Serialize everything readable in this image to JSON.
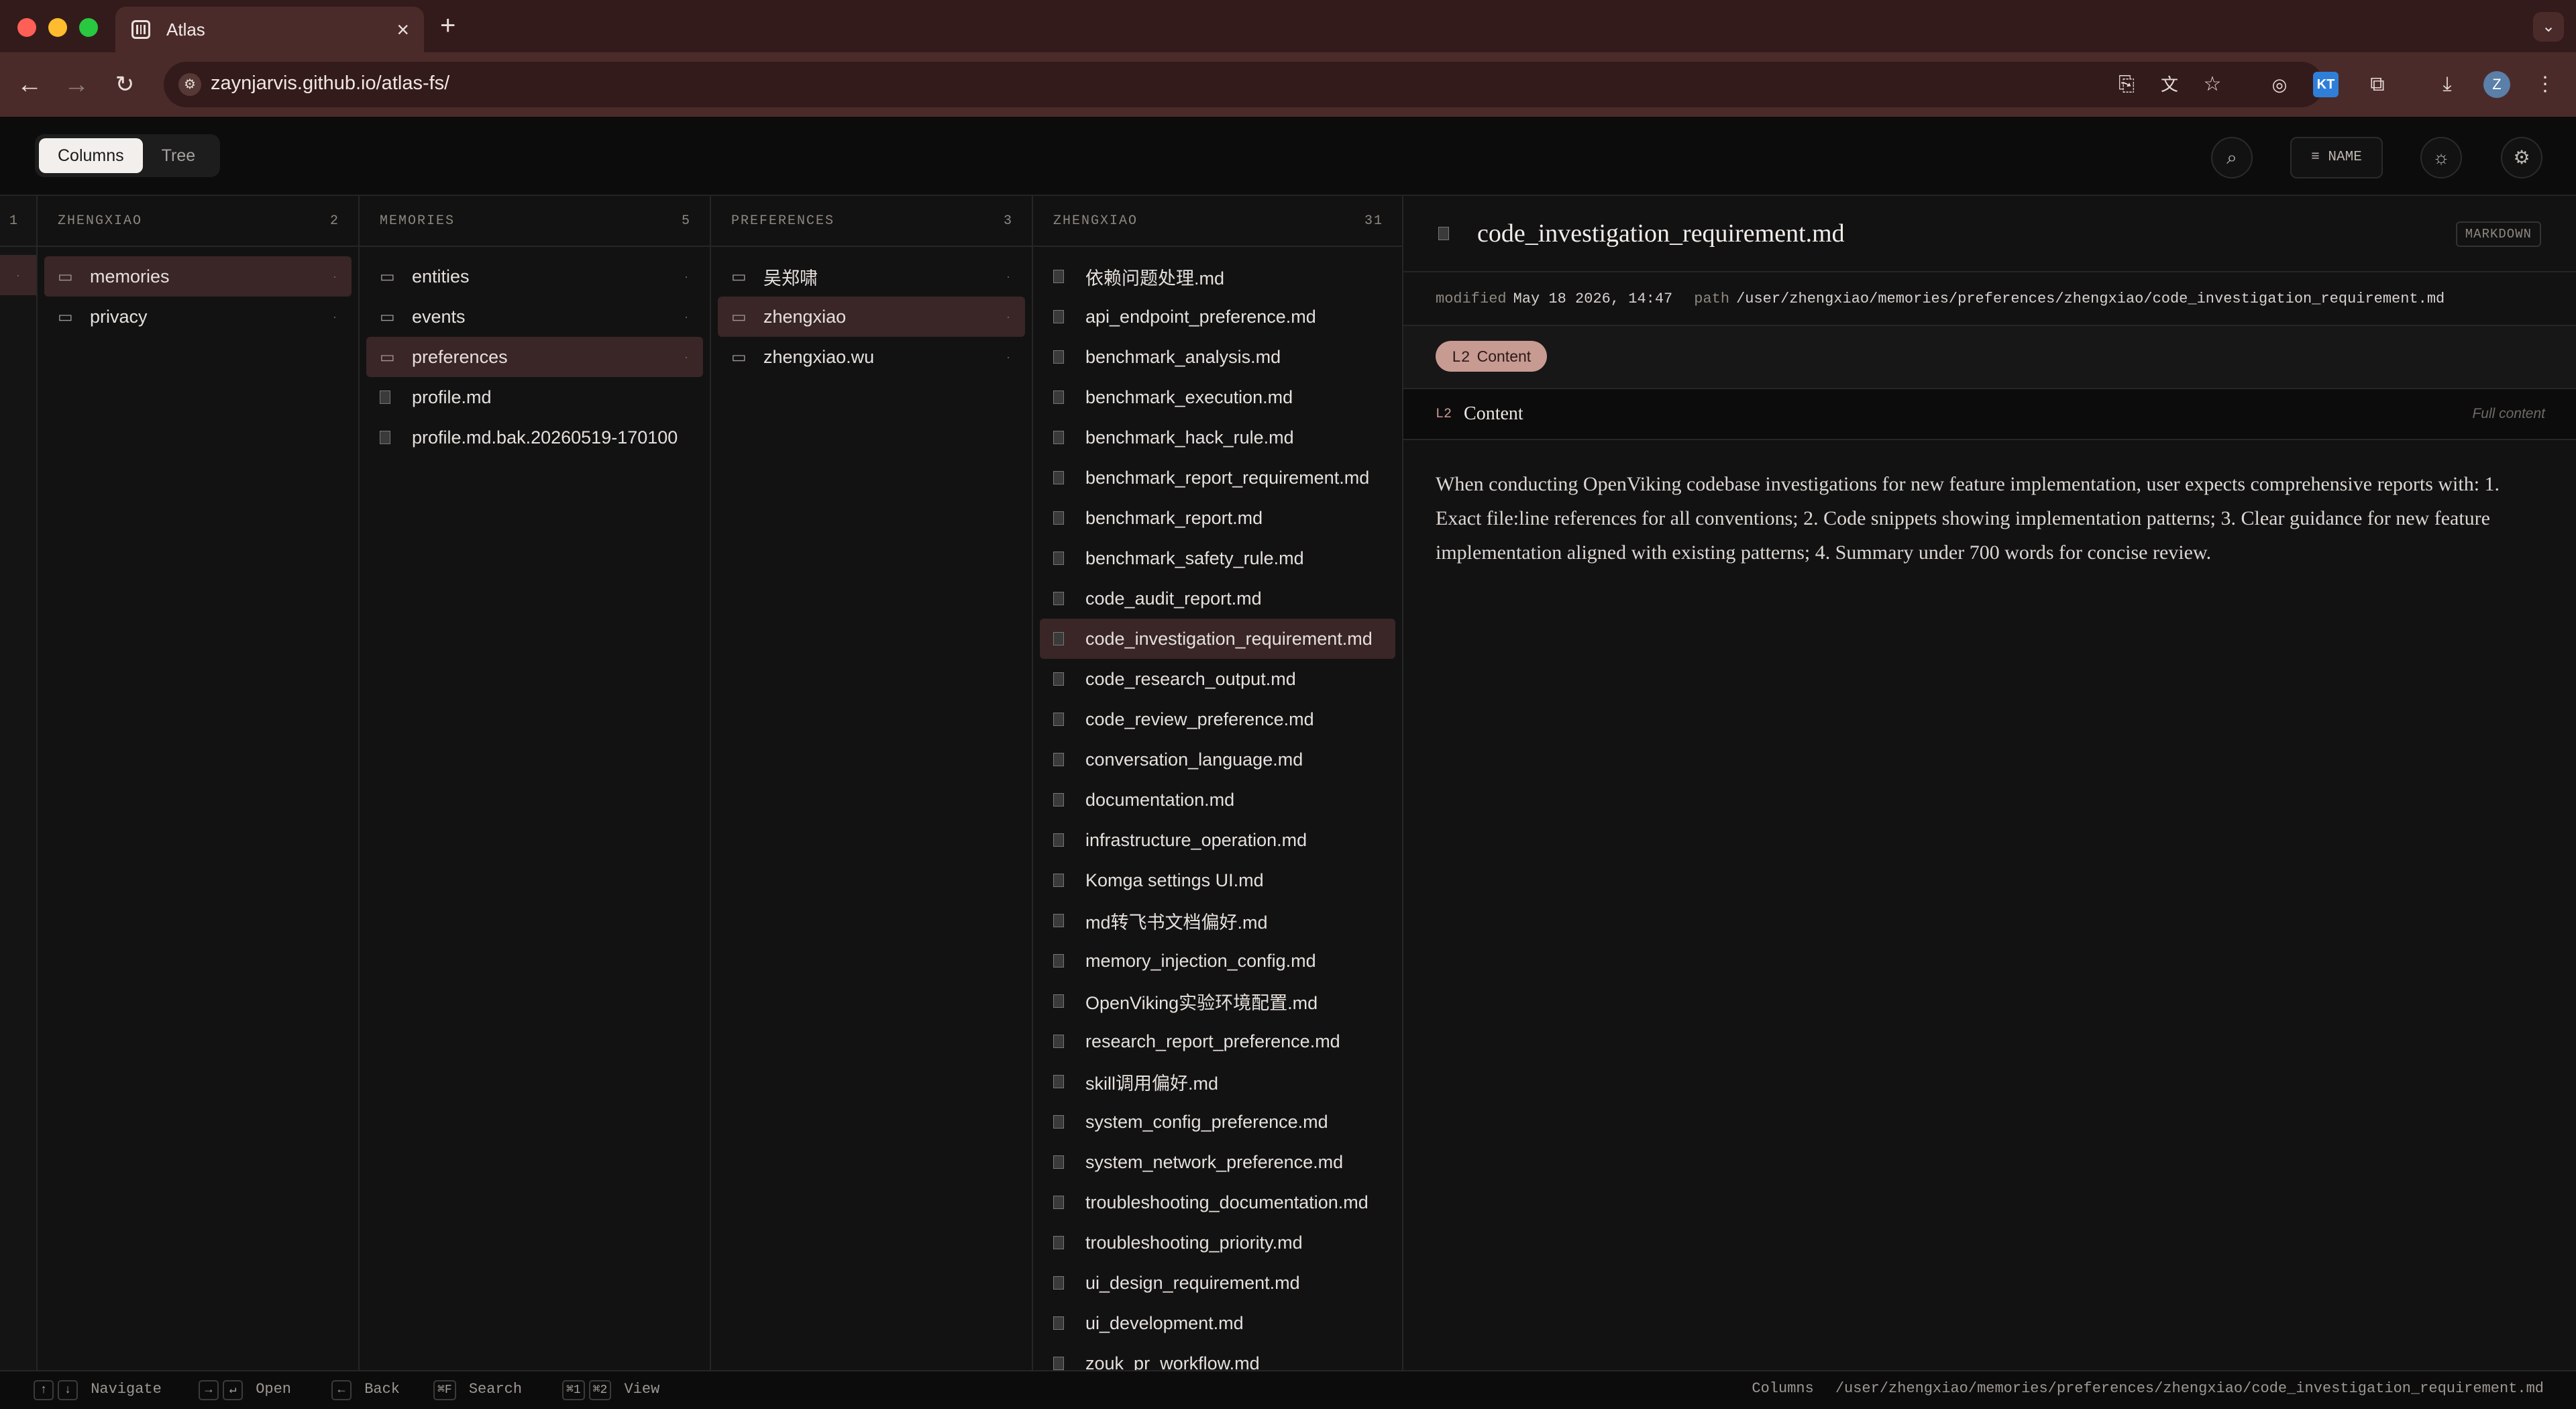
{
  "browser": {
    "tab_title": "Atlas",
    "url": "zaynjarvis.github.io/atlas-fs/",
    "profile_initial": "Z",
    "ext_kt": "KT"
  },
  "app": {
    "view_modes": [
      "Columns",
      "Tree"
    ],
    "sort_label": "NAME"
  },
  "columns": [
    {
      "title": "ZHENGXIAO",
      "count": "2",
      "items": [
        {
          "name": "memories",
          "type": "folder",
          "selected": true
        },
        {
          "name": "privacy",
          "type": "folder"
        }
      ]
    },
    {
      "title": "MEMORIES",
      "count": "5",
      "items": [
        {
          "name": "entities",
          "type": "folder"
        },
        {
          "name": "events",
          "type": "folder"
        },
        {
          "name": "preferences",
          "type": "folder",
          "selected": true
        },
        {
          "name": "profile.md",
          "type": "file"
        },
        {
          "name": "profile.md.bak.20260519-170100",
          "type": "file"
        }
      ]
    },
    {
      "title": "PREFERENCES",
      "count": "3",
      "items": [
        {
          "name": "吴郑啸",
          "type": "folder"
        },
        {
          "name": "zhengxiao",
          "type": "folder",
          "selected": true
        },
        {
          "name": "zhengxiao.wu",
          "type": "folder"
        }
      ]
    },
    {
      "title": "ZHENGXIAO",
      "count": "31",
      "items": [
        {
          "name": "依赖问题处理.md",
          "type": "file"
        },
        {
          "name": "api_endpoint_preference.md",
          "type": "file"
        },
        {
          "name": "benchmark_analysis.md",
          "type": "file"
        },
        {
          "name": "benchmark_execution.md",
          "type": "file"
        },
        {
          "name": "benchmark_hack_rule.md",
          "type": "file"
        },
        {
          "name": "benchmark_report_requirement.md",
          "type": "file"
        },
        {
          "name": "benchmark_report.md",
          "type": "file"
        },
        {
          "name": "benchmark_safety_rule.md",
          "type": "file"
        },
        {
          "name": "code_audit_report.md",
          "type": "file"
        },
        {
          "name": "code_investigation_requirement.md",
          "type": "file",
          "selected": true
        },
        {
          "name": "code_research_output.md",
          "type": "file"
        },
        {
          "name": "code_review_preference.md",
          "type": "file"
        },
        {
          "name": "conversation_language.md",
          "type": "file"
        },
        {
          "name": "documentation.md",
          "type": "file"
        },
        {
          "name": "infrastructure_operation.md",
          "type": "file"
        },
        {
          "name": "Komga settings UI.md",
          "type": "file"
        },
        {
          "name": "md转飞书文档偏好.md",
          "type": "file"
        },
        {
          "name": "memory_injection_config.md",
          "type": "file"
        },
        {
          "name": "OpenViking实验环境配置.md",
          "type": "file"
        },
        {
          "name": "research_report_preference.md",
          "type": "file"
        },
        {
          "name": "skill调用偏好.md",
          "type": "file"
        },
        {
          "name": "system_config_preference.md",
          "type": "file"
        },
        {
          "name": "system_network_preference.md",
          "type": "file"
        },
        {
          "name": "troubleshooting_documentation.md",
          "type": "file"
        },
        {
          "name": "troubleshooting_priority.md",
          "type": "file"
        },
        {
          "name": "ui_design_requirement.md",
          "type": "file"
        },
        {
          "name": "ui_development.md",
          "type": "file"
        },
        {
          "name": "zouk_pr_workflow.md",
          "type": "file"
        }
      ]
    }
  ],
  "strip": {
    "label": "1"
  },
  "preview": {
    "title": "code_investigation_requirement.md",
    "kind": "MARKDOWN",
    "modified_label": "modified",
    "modified": "May 18 2026, 14:47",
    "path_label": "path",
    "path": "/user/zhengxiao/memories/preferences/zhengxiao/code_investigation_requirement.md",
    "pill_level": "L2",
    "pill_label": "Content",
    "section_level": "L2",
    "section_title": "Content",
    "section_right": "Full content",
    "body": "When conducting OpenViking codebase investigations for new feature implementation, user expects comprehensive reports with: 1. Exact file:line references for all conventions; 2. Code snippets showing implementation patterns; 3. Clear guidance for new feature implementation aligned with existing patterns; 4. Summary under 700 words for concise review."
  },
  "status": {
    "navigate": "Navigate",
    "open": "Open",
    "back": "Back",
    "search": "Search",
    "view": "View",
    "k_up": "↑",
    "k_down": "↓",
    "k_right": "→",
    "k_enter": "↵",
    "k_left": "←",
    "k_search": "⌘F",
    "k_v1": "⌘1",
    "k_v2": "⌘2",
    "mode": "Columns",
    "path": "/user/zhengxiao/memories/preferences/zhengxiao/code_investigation_requirement.md"
  }
}
